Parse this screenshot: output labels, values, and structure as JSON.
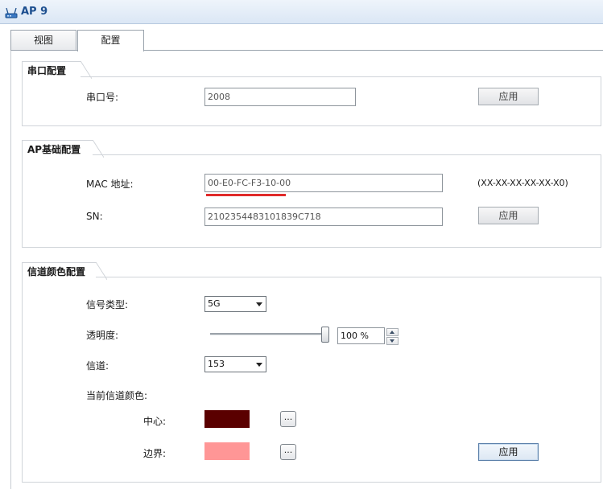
{
  "window": {
    "title": "AP 9",
    "icon": "ap-device-icon"
  },
  "tabs": [
    {
      "label": "视图",
      "active": false
    },
    {
      "label": "配置",
      "active": true
    }
  ],
  "serial_section": {
    "title": "串口配置",
    "serial_label": "串口号:",
    "serial_value": "2008",
    "apply_label": "应用"
  },
  "ap_basic_section": {
    "title": "AP基础配置",
    "mac_label": "MAC 地址:",
    "mac_value": "00-E0-FC-F3-10-00",
    "mac_hint": "(XX-XX-XX-XX-XX-X0)",
    "sn_label": "SN:",
    "sn_value": "2102354483101839C718",
    "apply_label": "应用"
  },
  "channel_color_section": {
    "title": "信道颜色配置",
    "signal_type_label": "信号类型:",
    "signal_type_value": "5G",
    "transparency_label": "透明度:",
    "transparency_value": "100 %",
    "transparency_level": 1.0,
    "channel_label": "信道:",
    "channel_value": "153",
    "current_color_label": "当前信道颜色:",
    "center_label": "中心:",
    "center_color": "#5a0000",
    "border_label": "边界:",
    "border_color": "#ff9696",
    "browse_label": "...",
    "apply_label": "应用"
  },
  "colors": {
    "title_text": "#1d4f8f",
    "mac_underline": "#e02a2a"
  }
}
